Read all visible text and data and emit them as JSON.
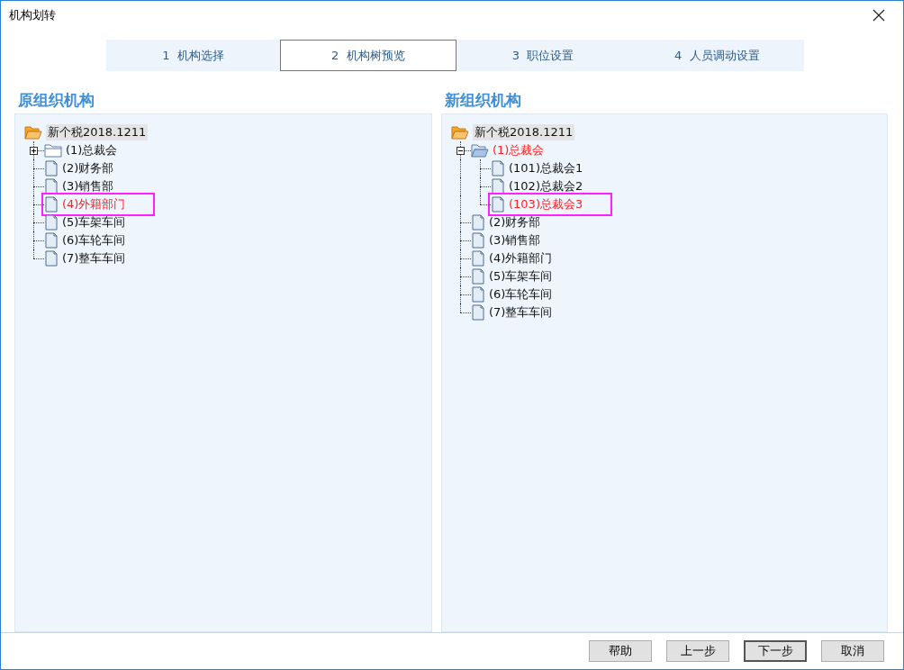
{
  "window": {
    "title": "机构划转"
  },
  "steps": [
    {
      "label": "1  机构选择",
      "selected": false
    },
    {
      "label": "2  机构树预览",
      "selected": true
    },
    {
      "label": "3  职位设置",
      "selected": false
    },
    {
      "label": "4  人员调动设置",
      "selected": false
    }
  ],
  "panels": [
    {
      "heading": "原组织机构",
      "tree": {
        "label": "新个税2018.1211",
        "kind": "root",
        "children": [
          {
            "label": "(1)总裁会",
            "kind": "folder",
            "expanded": false,
            "changed": false,
            "highlighted": false
          },
          {
            "label": "(2)财务部",
            "kind": "leaf",
            "changed": false,
            "highlighted": false
          },
          {
            "label": "(3)销售部",
            "kind": "leaf",
            "changed": false,
            "highlighted": false
          },
          {
            "label": "(4)外籍部门",
            "kind": "leaf",
            "changed": true,
            "highlighted": true
          },
          {
            "label": "(5)车架车间",
            "kind": "leaf",
            "changed": false,
            "highlighted": false
          },
          {
            "label": "(6)车轮车间",
            "kind": "leaf",
            "changed": false,
            "highlighted": false
          },
          {
            "label": "(7)整车车间",
            "kind": "leaf",
            "changed": false,
            "highlighted": false
          }
        ]
      }
    },
    {
      "heading": "新组织机构",
      "tree": {
        "label": "新个税2018.1211",
        "kind": "root",
        "children": [
          {
            "label": "(1)总裁会",
            "kind": "folder",
            "expanded": true,
            "changed": true,
            "highlighted": false,
            "children": [
              {
                "label": "(101)总裁会1",
                "kind": "leaf",
                "changed": false,
                "highlighted": false
              },
              {
                "label": "(102)总裁会2",
                "kind": "leaf",
                "changed": false,
                "highlighted": false
              },
              {
                "label": "(103)总裁会3",
                "kind": "leaf",
                "changed": true,
                "highlighted": true
              }
            ]
          },
          {
            "label": "(2)财务部",
            "kind": "leaf",
            "changed": false,
            "highlighted": false
          },
          {
            "label": "(3)销售部",
            "kind": "leaf",
            "changed": false,
            "highlighted": false
          },
          {
            "label": "(4)外籍部门",
            "kind": "leaf",
            "changed": false,
            "highlighted": false
          },
          {
            "label": "(5)车架车间",
            "kind": "leaf",
            "changed": false,
            "highlighted": false
          },
          {
            "label": "(6)车轮车间",
            "kind": "leaf",
            "changed": false,
            "highlighted": false
          },
          {
            "label": "(7)整车车间",
            "kind": "leaf",
            "changed": false,
            "highlighted": false
          }
        ]
      }
    }
  ],
  "buttons": [
    {
      "label": "帮助",
      "default": false
    },
    {
      "label": "上一步",
      "default": false
    },
    {
      "label": "下一步",
      "default": true
    },
    {
      "label": "取消",
      "default": false
    }
  ]
}
